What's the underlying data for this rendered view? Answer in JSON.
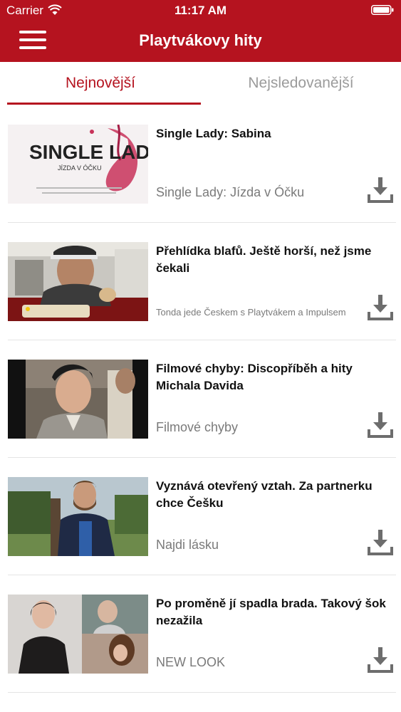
{
  "status": {
    "carrier": "Carrier",
    "time": "11:17 AM"
  },
  "header": {
    "title": "Playtvákovy hity"
  },
  "tabs": [
    {
      "label": "Nejnovější",
      "active": true
    },
    {
      "label": "Nejsledovanější",
      "active": false
    }
  ],
  "colors": {
    "brand": "#b5131f",
    "inactive_tab": "#9b9b9b",
    "subtitle": "#7a7a7a"
  },
  "thumb_logo": {
    "line1": "SINGLE LADY",
    "line2": "JÍZDA V ÓČKU"
  },
  "videos": [
    {
      "title": "Single Lady: Sabina",
      "subtitle": "Single Lady: Jízda v Óčku",
      "icon": "download-icon"
    },
    {
      "title": "Přehlídka blafů. Ještě horší, než jsme čekali",
      "subtitle": "Tonda jede Českem s Playtvákem a Impulsem",
      "icon": "download-icon"
    },
    {
      "title": "Filmové chyby: Discopříběh a hity Michala Davida",
      "subtitle": "Filmové chyby",
      "icon": "download-icon"
    },
    {
      "title": "Vyznává otevřený vztah. Za partnerku chce Češku",
      "subtitle": "Najdi lásku",
      "icon": "download-icon"
    },
    {
      "title": "Po proměně jí spadla brada. Takový šok nezažila",
      "subtitle": "NEW LOOK",
      "icon": "download-icon"
    }
  ]
}
